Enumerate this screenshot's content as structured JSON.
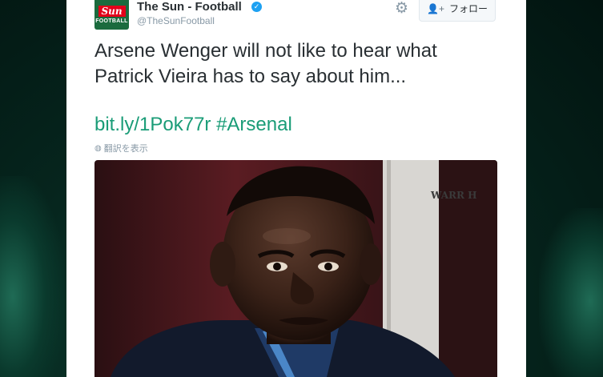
{
  "tweet": {
    "author_name": "The Sun - Football",
    "author_handle": "@TheSunFootball",
    "avatar_brand": "Sun",
    "avatar_sub": "FOOTBALL",
    "follow_label": "フォロー",
    "text": "Arsene Wenger will not like to hear what Patrick Vieira has to say about him...",
    "link": "bit.ly/1Pok77r",
    "hashtag": "#Arsenal",
    "translate_label": "翻訳を表示",
    "sign_text": "WARR H"
  },
  "colors": {
    "link": "#1a9c77",
    "verified": "#1da1f2",
    "brand_red": "#e2001a"
  },
  "icons": [
    "verified-icon",
    "gear-icon",
    "follow-user-icon",
    "globe-icon"
  ]
}
